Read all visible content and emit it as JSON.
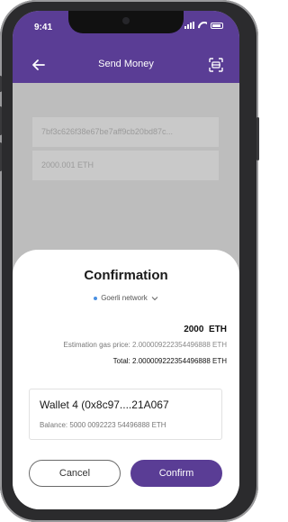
{
  "status_bar": {
    "time": "9:41"
  },
  "app_bar": {
    "title": "Send Money"
  },
  "form": {
    "address_value": "7bf3c626f38e67be7aff9cb20bd87c...",
    "amount_value": "2000.001 ETH"
  },
  "sheet": {
    "title": "Confirmation",
    "network": "Goerli network",
    "amount": "2000  ETH",
    "gas_label": "Estimation gas price:",
    "gas_value": "2.000009222354496888 ETH",
    "total_label": "Total:",
    "total_value": "2.000009222354496888 ETH",
    "wallet_name": "Wallet 4 (0x8c97....21A067",
    "wallet_balance_label": "Balance:",
    "wallet_balance_value": "5000 0092223 54496888 ETH",
    "cancel_label": "Cancel",
    "confirm_label": "Confirm"
  },
  "colors": {
    "brand": "#5a3d95",
    "network_dot": "#4a90e2"
  },
  "icons": [
    "back-arrow-icon",
    "scan-icon",
    "chevron-down-icon",
    "signal-icon",
    "wifi-icon",
    "battery-icon"
  ]
}
